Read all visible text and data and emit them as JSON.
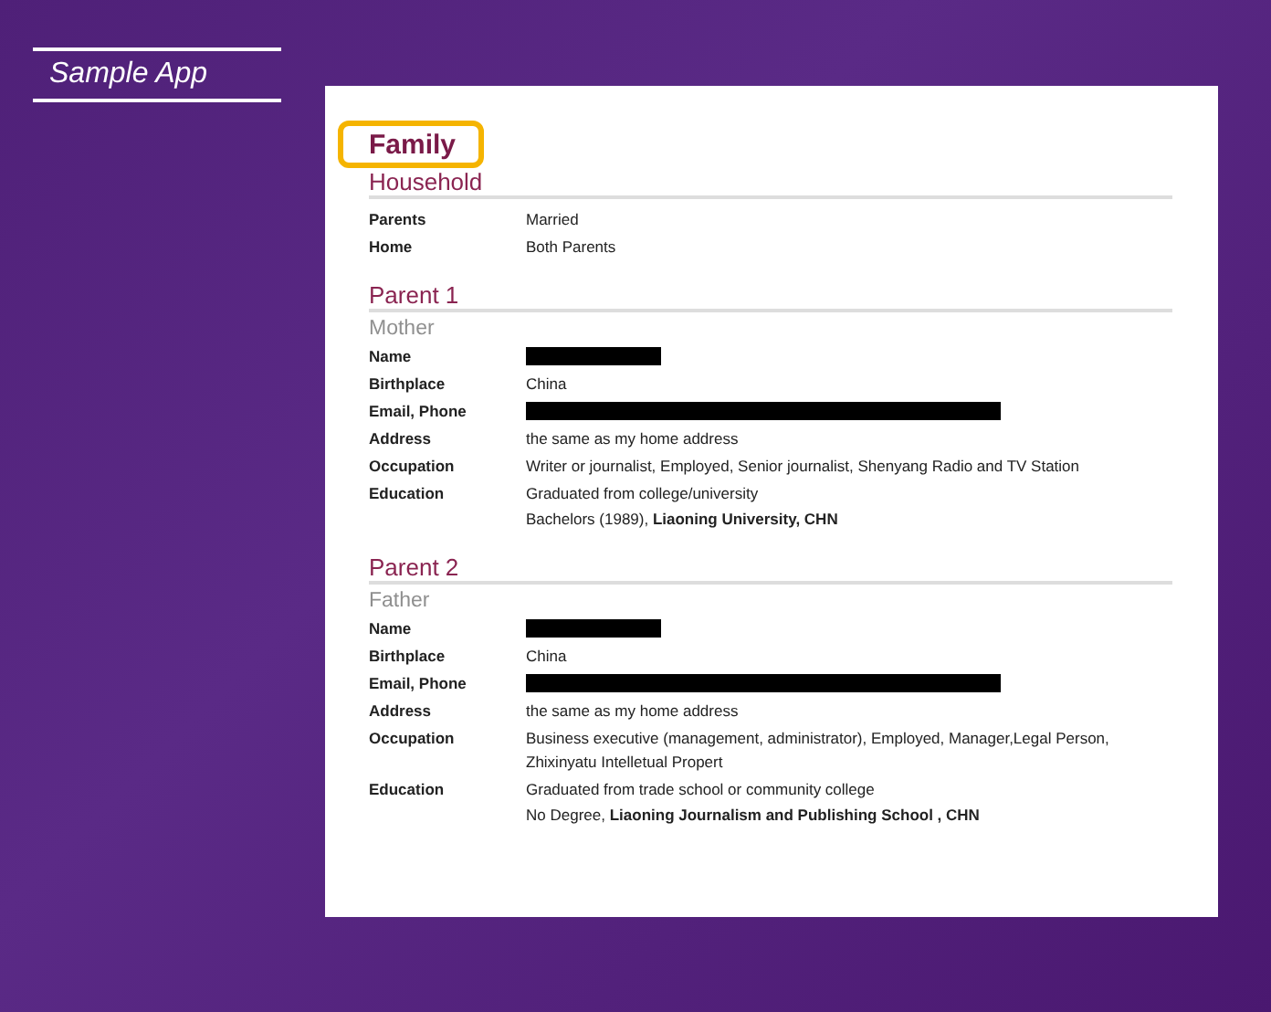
{
  "app_label": "Sample App",
  "page_title": "Family",
  "sections": [
    {
      "heading": "Household",
      "rows": [
        {
          "label": "Parents",
          "kind": "text",
          "value": "Married"
        },
        {
          "label": "Home",
          "kind": "text",
          "value": "Both Parents"
        }
      ]
    },
    {
      "heading": "Parent 1",
      "subheading": "Mother",
      "rows": [
        {
          "label": "Name",
          "kind": "redacted"
        },
        {
          "label": "Birthplace",
          "kind": "text",
          "value": "China"
        },
        {
          "label": "Email, Phone",
          "kind": "redactedwide"
        },
        {
          "label": "Address",
          "kind": "text",
          "value": "the same as my home address"
        },
        {
          "label": "Occupation",
          "kind": "text",
          "value": "Writer or journalist, Employed, Senior journalist, Shenyang Radio and TV Station"
        },
        {
          "label": "Education",
          "kind": "lines",
          "lines": [
            "Graduated from college/university",
            "Bachelors (1989), **Liaoning University, CHN**"
          ]
        }
      ]
    },
    {
      "heading": "Parent 2",
      "subheading": "Father",
      "rows": [
        {
          "label": "Name",
          "kind": "redacted"
        },
        {
          "label": "Birthplace",
          "kind": "text",
          "value": "China"
        },
        {
          "label": "Email, Phone",
          "kind": "redactedwide"
        },
        {
          "label": "Address",
          "kind": "text",
          "value": "the same as my home address"
        },
        {
          "label": "Occupation",
          "kind": "text",
          "value": "Business executive (management, administrator), Employed, Manager,Legal Person, Zhixinyatu Intelletual Propert"
        },
        {
          "label": "Education",
          "kind": "lines",
          "lines": [
            "Graduated from trade school or community college",
            "No Degree, **Liaoning Journalism and Publishing School , CHN**"
          ]
        }
      ]
    }
  ]
}
